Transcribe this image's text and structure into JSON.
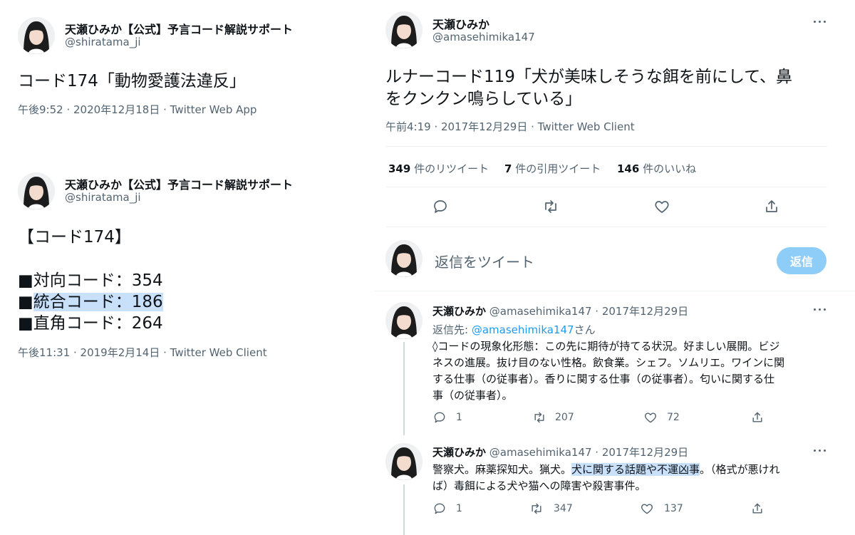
{
  "left_tweet1": {
    "name": "天瀬ひみか【公式】予言コード解説サポート",
    "handle": "@shiratama_ji",
    "text": "コード174「動物愛護法違反」",
    "meta": "午後9:52 · 2020年12月18日 · Twitter Web App"
  },
  "left_tweet2": {
    "name": "天瀬ひみか【公式】予言コード解説サポート",
    "handle": "@shiratama_ji",
    "heading": "【コード174】",
    "line1": "■対向コード：354",
    "line2_prefix": "■",
    "line2_highlight": "統合コード：186",
    "line3": "■直角コード：264",
    "meta": "午後11:31 · 2019年2月14日 · Twitter Web Client"
  },
  "main_tweet": {
    "name": "天瀬ひみか",
    "handle": "@amasehimika147",
    "text_line1": "ルナーコード119「犬が美味しそうな餌を前にして、鼻",
    "text_line2": "をクンクン鳴らしている」",
    "meta": "午前4:19 · 2017年12月29日 · Twitter Web Client",
    "stats": {
      "retweets": "349",
      "retweets_label": "件のリツイート",
      "quotes": "7",
      "quotes_label": "件の引用ツイート",
      "likes": "146",
      "likes_label": "件のいいね"
    }
  },
  "reply_box": {
    "placeholder": "返信をツイート",
    "button": "返信"
  },
  "reply1": {
    "name": "天瀬ひみか",
    "handle_date": "@amasehimika147 · 2017年12月29日",
    "reply_to_prefix": "返信先: ",
    "reply_to_handle": "@amasehimika147",
    "reply_to_suffix": "さん",
    "lines": [
      "◊コードの現象化形態：この先に期待が持てる状況。好ましい展開。ビジ",
      "ネスの進展。抜け目のない性格。飲食業。シェフ。ソムリエ。ワインに関",
      "する仕事（の従事者）。香りに関する仕事（の従事者）。匂いに関する仕",
      "事（の従事者）。"
    ],
    "actions": {
      "replies": "1",
      "retweets": "207",
      "likes": "72"
    }
  },
  "reply2": {
    "name": "天瀬ひみか",
    "handle_date": "@amasehimika147 · 2017年12月29日",
    "line1_a": "警察犬。麻薬探知犬。猟犬。",
    "line1_hl": "犬に関する話題や不運凶事",
    "line1_b": "。（格式が悪けれ",
    "line2": "ば）毒餌による犬や猫への障害や殺害事件。",
    "actions": {
      "replies": "1",
      "retweets": "347",
      "likes": "137"
    }
  },
  "colors": {
    "text": "#0f1419",
    "secondary": "#536471",
    "link": "#1d9bf0",
    "highlight": "#c9e0fb",
    "reply_button": "#8ecdf8"
  },
  "icons": [
    "avatar",
    "more-icon",
    "reply-icon",
    "retweet-icon",
    "like-icon",
    "share-icon"
  ]
}
